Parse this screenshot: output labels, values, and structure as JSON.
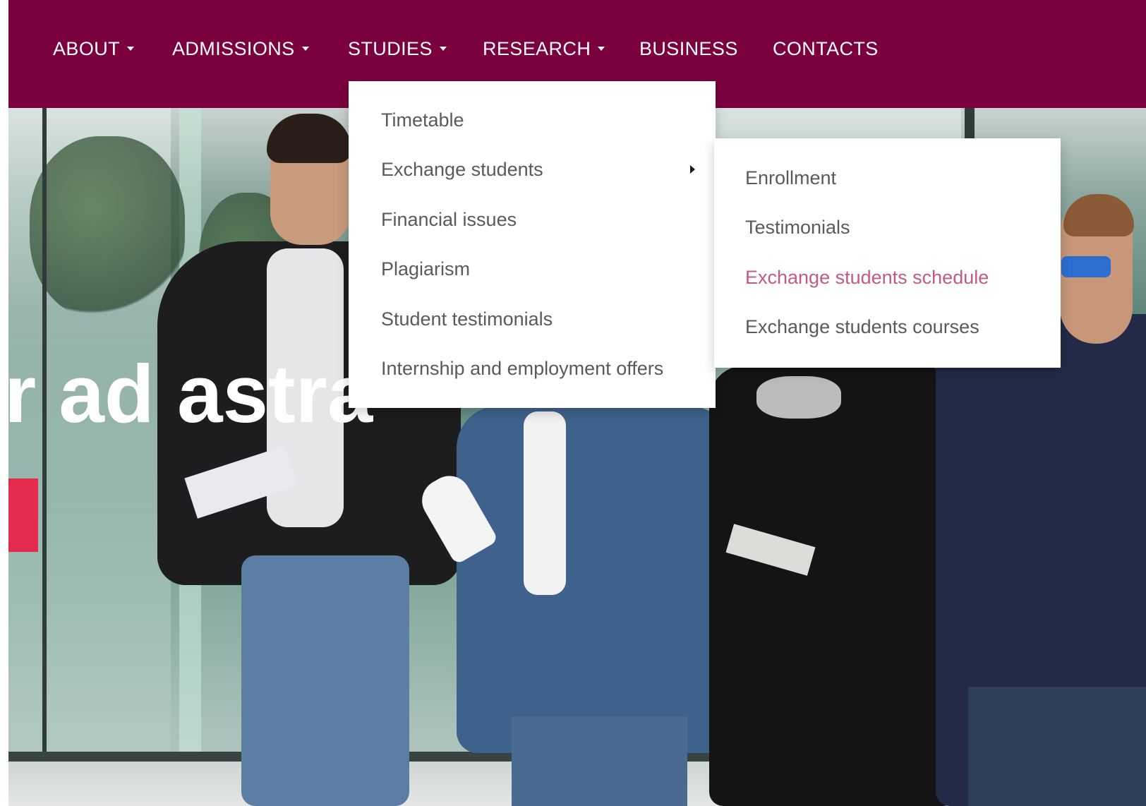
{
  "colors": {
    "nav_bg": "#7a003e",
    "nav_text": "#ffffff",
    "menu_text": "#5a5a5a",
    "active_link": "#c45a83",
    "accent": "#e42a4e"
  },
  "nav": {
    "items": [
      {
        "label": "ABOUT",
        "has_dropdown": true,
        "icon": "caret-down-icon"
      },
      {
        "label": "ADMISSIONS",
        "has_dropdown": true,
        "icon": "caret-down-icon"
      },
      {
        "label": "STUDIES",
        "has_dropdown": true,
        "icon": "caret-down-icon",
        "open": true
      },
      {
        "label": "RESEARCH",
        "has_dropdown": true,
        "icon": "caret-down-icon"
      },
      {
        "label": "BUSINESS",
        "has_dropdown": false
      },
      {
        "label": "CONTACTS",
        "has_dropdown": false
      }
    ]
  },
  "studies_menu": {
    "items": [
      {
        "label": "Timetable"
      },
      {
        "label": "Exchange students",
        "has_submenu": true,
        "icon": "caret-right-icon",
        "open": true
      },
      {
        "label": "Financial issues"
      },
      {
        "label": "Plagiarism"
      },
      {
        "label": "Student testimonials"
      },
      {
        "label": "Internship and employment offers"
      }
    ]
  },
  "exchange_submenu": {
    "items": [
      {
        "label": "Enrollment"
      },
      {
        "label": "Testimonials"
      },
      {
        "label": "Exchange students schedule",
        "highlighted": true
      },
      {
        "label": "Exchange students courses"
      }
    ]
  },
  "hero": {
    "heading": "r ad astra"
  }
}
